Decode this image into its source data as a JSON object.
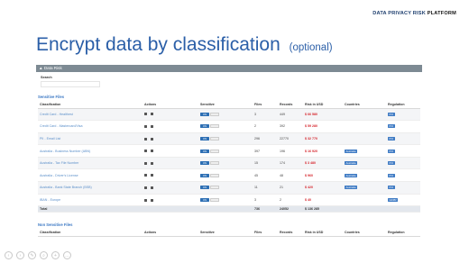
{
  "brand": {
    "part1": "DATA PRIVACY RISK",
    "part2": "PLATFORM"
  },
  "slide": {
    "title": "Encrypt data by classification",
    "optional": "(optional)"
  },
  "panel": {
    "title": "▲ Data Risk",
    "search_label": "Search",
    "search_placeholder": "",
    "sensitive_section": "Sensitive Files",
    "non_sensitive_section": "Non Sensitive Files",
    "columns": [
      "Classification",
      "Actions",
      "Sensitive",
      "Files",
      "Records",
      "Risk in USD",
      "Countries",
      "Regulation"
    ],
    "toggle_label": "ON",
    "rows": [
      {
        "classification": "Credit Card - Healthest",
        "files": "3",
        "records": "449",
        "risk": "$ 66 580",
        "country": "",
        "regulation": "PCI"
      },
      {
        "classification": "Credit Card - Mastercard/Visa",
        "files": "2",
        "records": "392",
        "risk": "$ 59 280",
        "country": "",
        "regulation": "PCI"
      },
      {
        "classification": "PII - Email List",
        "files": "296",
        "records": "22770",
        "risk": "$ 32 770",
        "country": "",
        "regulation": "PCI"
      },
      {
        "classification": "Australia - Business Number (ABN)",
        "files": "397",
        "records": "196",
        "risk": "$ 16 920",
        "country": "Australia",
        "regulation": "PCI"
      },
      {
        "classification": "Australia - Tax File Number",
        "files": "15",
        "records": "174",
        "risk": "$ 3 480",
        "country": "Australia",
        "regulation": "PCI"
      },
      {
        "classification": "Australia - Driver's License",
        "files": "45",
        "records": "48",
        "risk": "$ 960",
        "country": "Australia",
        "regulation": "PCI"
      },
      {
        "classification": "Australia - Bank State Branch (BSB)",
        "files": "11",
        "records": "21",
        "risk": "$ 420",
        "country": "Australia",
        "regulation": "PCI"
      },
      {
        "classification": "IBAN - Europe",
        "files": "3",
        "records": "2",
        "risk": "$ 40",
        "country": "",
        "regulation": "GDPR"
      }
    ],
    "total": {
      "label": "Total",
      "files": "736",
      "records": "24052",
      "risk": "$ 136 285"
    }
  },
  "colors": {
    "title": "#2b5fa8",
    "panel_header": "#7d8a93",
    "risk": "#d6262d",
    "badge": "#3f7bc4"
  },
  "navbar": {
    "icons": [
      "back-icon",
      "forward-icon",
      "pen-icon",
      "search-icon",
      "zoom-icon",
      "more-icon"
    ]
  }
}
